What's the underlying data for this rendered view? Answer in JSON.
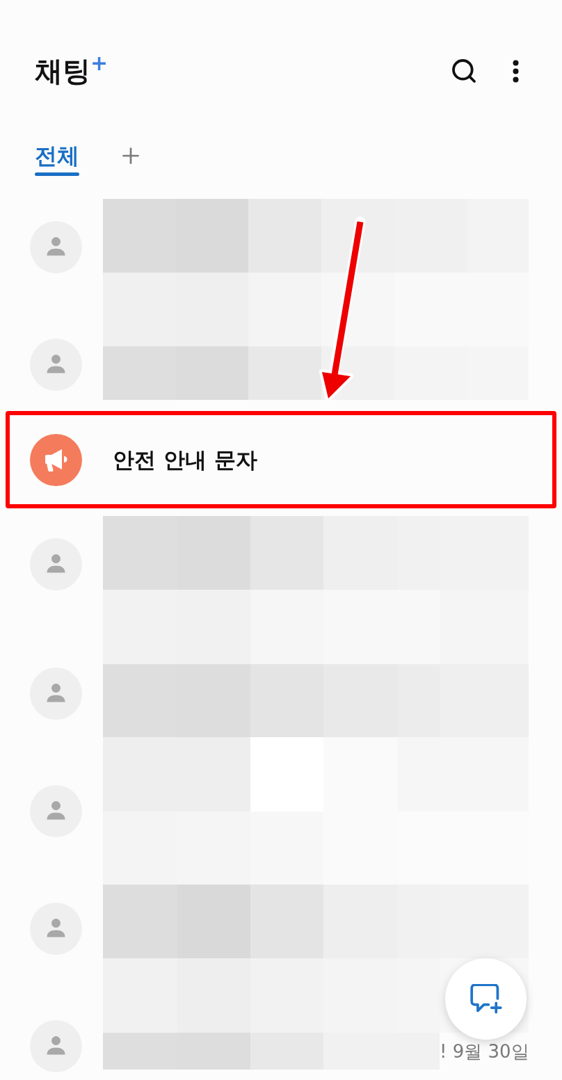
{
  "header": {
    "title": "채팅",
    "title_mark": "+"
  },
  "tabs": [
    {
      "label": "전체",
      "selected": true
    }
  ],
  "chat_list": [
    {
      "kind": "masked"
    },
    {
      "kind": "masked"
    },
    {
      "kind": "notice",
      "name": "안전 안내 문자",
      "highlighted": true
    },
    {
      "kind": "masked"
    },
    {
      "kind": "masked"
    },
    {
      "kind": "masked"
    },
    {
      "kind": "masked"
    },
    {
      "kind": "masked",
      "date": "! 9월 30일"
    }
  ]
}
